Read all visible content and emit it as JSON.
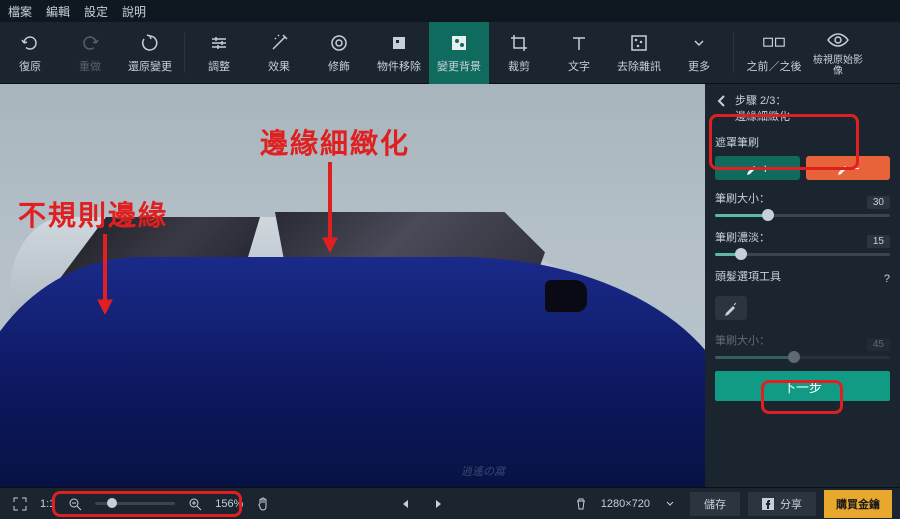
{
  "menu": {
    "file": "檔案",
    "edit": "編輯",
    "settings": "設定",
    "help": "說明"
  },
  "tools": {
    "undo": "復原",
    "redo": "重做",
    "revert": "還原變更",
    "adjust": "調整",
    "effects": "效果",
    "retouch": "修飾",
    "remove": "物件移除",
    "changebg": "變更背景",
    "crop": "裁剪",
    "text": "文字",
    "noise": "去除雜訊",
    "more": "更多",
    "beforeafter": "之前／之後",
    "original": "檢視原始影像"
  },
  "annotations": {
    "irregular": "不規則邊緣",
    "refine": "邊緣細緻化"
  },
  "sidebar": {
    "step_num": "步驟 2/3：",
    "step_name": "邊緣細緻化",
    "mask_brush": "遮罩筆刷",
    "brush_size_label": "筆刷大小：",
    "brush_size_val": "30",
    "brush_opacity_label": "筆刷濃淡：",
    "brush_opacity_val": "15",
    "hair_label": "頭髮選項工具",
    "hair_brush_label": "筆刷大小：",
    "hair_brush_val": "45",
    "next": "下一步"
  },
  "status": {
    "fit": "1:1",
    "zoom": "156%",
    "dims": "1280×720",
    "save": "儲存",
    "share": "分享",
    "buy": "購買金鑰"
  },
  "watermark": "逍遙の窩"
}
